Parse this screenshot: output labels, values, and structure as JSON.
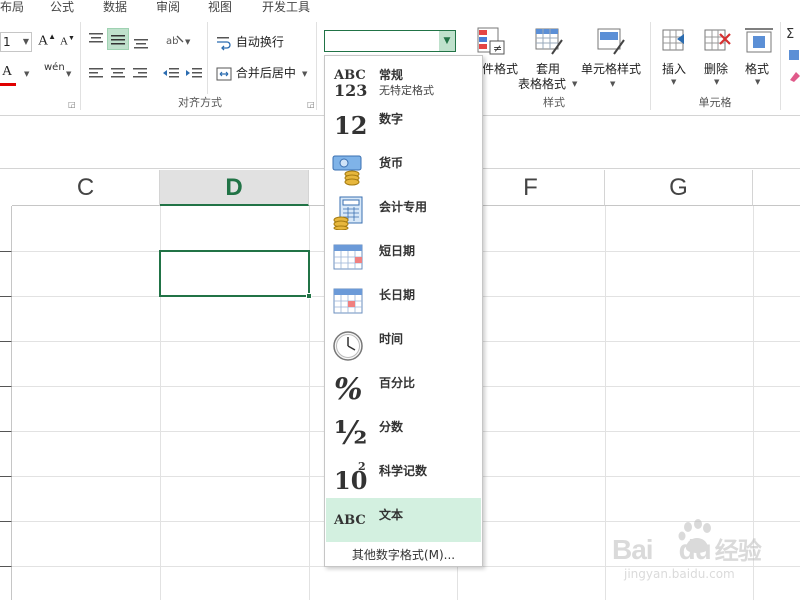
{
  "tabs": [
    {
      "label": "布局"
    },
    {
      "label": "公式"
    },
    {
      "label": "数据"
    },
    {
      "label": "审阅"
    },
    {
      "label": "视图"
    },
    {
      "label": "开发工具"
    }
  ],
  "ribbon": {
    "font_size_value": "1",
    "phonetic_label": "wén",
    "wrap_text_label": "自动换行",
    "merge_center_label": "合并后居中",
    "alignment_group": "对齐方式",
    "cond_format_label": "件格式",
    "table_format_label_1": "套用",
    "table_format_label_2": "表格格式",
    "cell_style_label": "单元格样式",
    "styles_group": "样式",
    "insert_label": "插入",
    "delete_label": "删除",
    "format_label": "格式",
    "cells_group": "单元格",
    "number_format_value": ""
  },
  "columns": [
    {
      "label": "C"
    },
    {
      "label": "D"
    },
    {
      "label": ""
    },
    {
      "label": "F"
    },
    {
      "label": "G"
    }
  ],
  "dropdown": {
    "items": [
      {
        "label": "常规",
        "sub": "无特定格式",
        "icon": "abc-123-icon"
      },
      {
        "label": "数字",
        "sub": "",
        "icon": "number-12-icon"
      },
      {
        "label": "货币",
        "sub": "",
        "icon": "currency-icon"
      },
      {
        "label": "会计专用",
        "sub": "",
        "icon": "accounting-icon"
      },
      {
        "label": "短日期",
        "sub": "",
        "icon": "calendar-icon"
      },
      {
        "label": "长日期",
        "sub": "",
        "icon": "calendar-icon"
      },
      {
        "label": "时间",
        "sub": "",
        "icon": "clock-icon"
      },
      {
        "label": "百分比",
        "sub": "",
        "icon": "percent-icon"
      },
      {
        "label": "分数",
        "sub": "",
        "icon": "fraction-icon"
      },
      {
        "label": "科学记数",
        "sub": "",
        "icon": "scientific-icon"
      },
      {
        "label": "文本",
        "sub": "",
        "icon": "abc-text-icon"
      }
    ],
    "selected": "文本",
    "more_label": "其他数字格式(M)..."
  },
  "icon_glyphs": {
    "abc": "ABC",
    "n123": "123",
    "n12": "12",
    "percent": "%",
    "half": "½",
    "ten": "10",
    "sup2": "2"
  },
  "watermark": {
    "brand": "Bai",
    "brand2": "du",
    "cn": "经验",
    "url": "jingyan.baidu.com"
  },
  "colors": {
    "accent": "#217346",
    "selected_bg": "#d3f0e0",
    "header_selected_bg": "#e1e1e1"
  }
}
